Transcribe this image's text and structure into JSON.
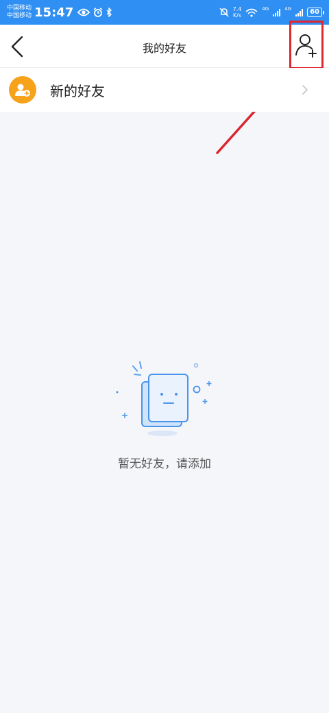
{
  "status_bar": {
    "carrier_1": "中国移动",
    "carrier_2": "中国移动",
    "time": "15:47",
    "net_speed_value": "7.4",
    "net_speed_unit": "K/s",
    "network_1": "4G",
    "network_2": "4G",
    "battery": "60",
    "icons": [
      "eye-icon",
      "alarm-icon",
      "bluetooth-icon",
      "mute-icon",
      "wifi-icon",
      "signal-icon",
      "battery-icon"
    ]
  },
  "header": {
    "title": "我的好友",
    "back_icon": "chevron-left-icon",
    "add_icon": "add-user-icon"
  },
  "new_friends": {
    "label": "新的好友",
    "icon": "new-friend-icon",
    "icon_color": "#f7a21b"
  },
  "empty_state": {
    "message": "暂无好友，请添加"
  },
  "colors": {
    "status_bar": "#2f8ff2",
    "highlight": "#e0262f",
    "background": "#f5f6fa"
  }
}
